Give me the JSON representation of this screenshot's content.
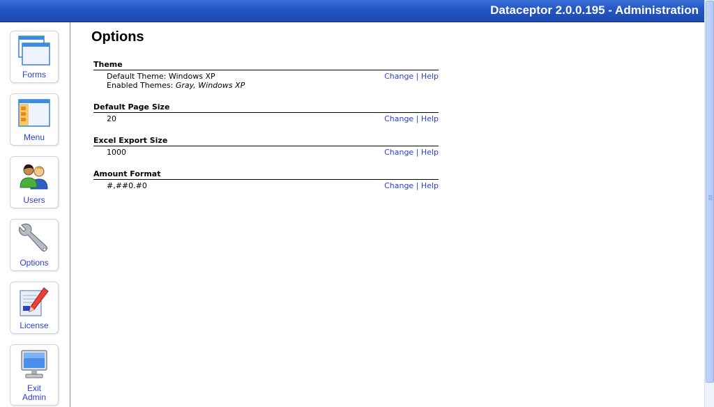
{
  "header": {
    "title": "Dataceptor 2.0.0.195 - Administration"
  },
  "sidebar": {
    "items": [
      {
        "label": "Forms",
        "icon": "forms-window-icon"
      },
      {
        "label": "Menu",
        "icon": "menu-window-icon"
      },
      {
        "label": "Users",
        "icon": "users-icon"
      },
      {
        "label": "Options",
        "icon": "wrench-icon"
      },
      {
        "label": "License",
        "icon": "license-pen-icon"
      },
      {
        "label_line1": "Exit",
        "label_line2": "Admin",
        "icon": "monitor-icon"
      }
    ]
  },
  "main": {
    "title": "Options",
    "change_label": "Change",
    "help_label": "Help",
    "separator": "|",
    "sections": [
      {
        "heading": "Theme",
        "rows": [
          {
            "label": "Default Theme:",
            "value": "Windows XP"
          },
          {
            "label": "Enabled Themes:",
            "value": "Gray, Windows XP"
          }
        ]
      },
      {
        "heading": "Default Page Size",
        "rows": [
          {
            "value": "20"
          }
        ]
      },
      {
        "heading": "Excel Export Size",
        "rows": [
          {
            "value": "1000"
          }
        ]
      },
      {
        "heading": "Amount Format",
        "rows": [
          {
            "value": "#,##0.#0"
          }
        ]
      }
    ]
  },
  "colors": {
    "title_bar": "#2455c3",
    "link": "#2a3fd6"
  }
}
